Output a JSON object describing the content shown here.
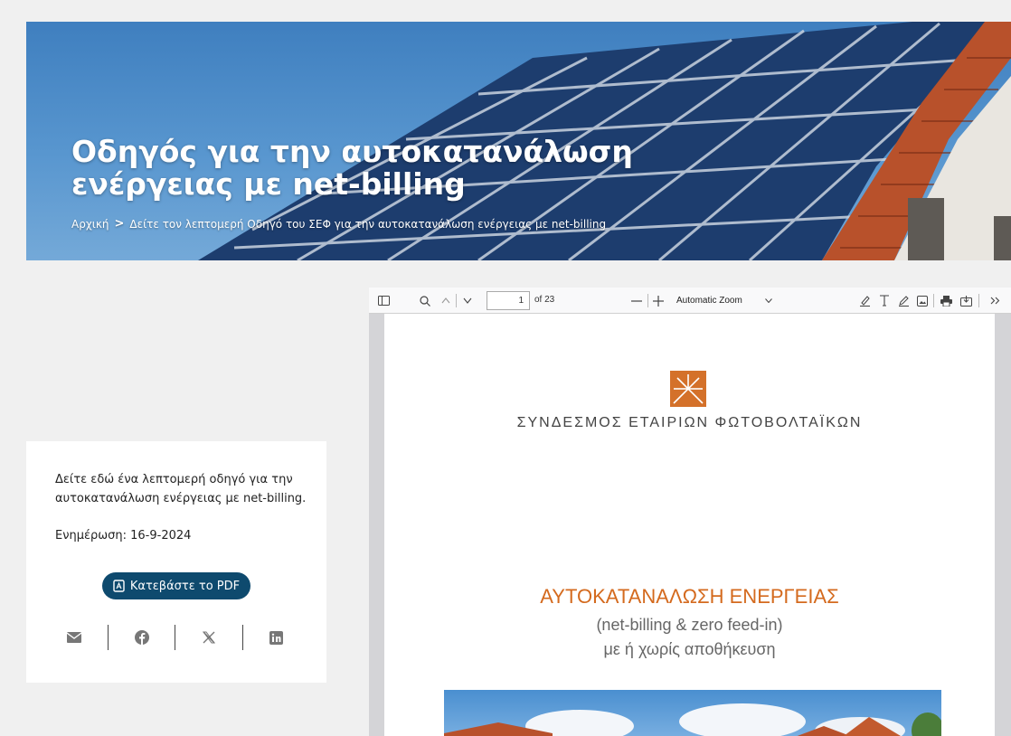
{
  "hero": {
    "title_line1": "Οδηγός για την αυτοκατανάλωση",
    "title_line2": "ενέργειας με net-billing",
    "breadcrumb": {
      "home": "Αρχική",
      "separator": ">",
      "current": "Δείτε τον λεπτομερή Οδηγό του ΣΕΦ για την αυτοκατανάλωση ενέργειας με net-billing"
    }
  },
  "card": {
    "description": "Δείτε εδώ ένα λεπτομερή οδηγό για την αυτοκατανάλωση ενέργειας με net-billing.",
    "update": "Ενημέρωση: 16-9-2024",
    "download_label": "Κατεβάστε το PDF",
    "share_icons": [
      "mail-icon",
      "facebook-icon",
      "x-icon",
      "linkedin-icon"
    ]
  },
  "viewer": {
    "page_current": "1",
    "page_total": "of 23",
    "zoom": "Automatic Zoom",
    "document": {
      "org": "ΣΥΝΔΕΣΜΟΣ ΕΤΑΙΡΙΩΝ ΦΩΤΟΒΟΛΤΑΪΚΩΝ",
      "title": "ΑΥΤΟΚΑΤΑΝΑΛΩΣΗ ΕΝΕΡΓΕΙΑΣ",
      "subtitle1": "(net-billing & zero feed-in)",
      "subtitle2": "με ή χωρίς αποθήκευση"
    }
  },
  "colors": {
    "button_bg": "#0e4a6e",
    "doc_title": "#d46a1e",
    "logo": "#d4712a"
  }
}
